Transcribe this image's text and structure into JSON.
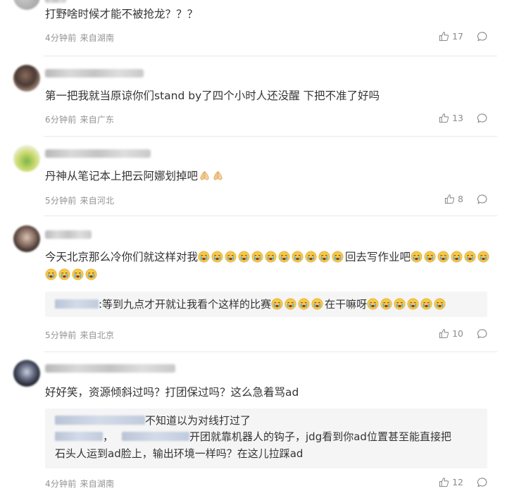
{
  "comments": [
    {
      "text": "打野啥时候才能不被抢龙？？？",
      "time": "4分钟前",
      "location": "来自湖南",
      "likes": "17"
    },
    {
      "text": "第一把我就当原谅你们stand by了四个小时人还没醒 下把不准了好吗",
      "time": "6分钟前",
      "location": "来自广东",
      "likes": "13"
    },
    {
      "text": "丹神从笔记本上把云阿娜划掉吧",
      "time": "5分钟前",
      "location": "来自河北",
      "likes": "8"
    },
    {
      "text_a": "今天北京那么冷你们就这样对我",
      "text_b": "回去写作业吧",
      "reply_text_a": ":等到九点才开就让我看个这样的比赛",
      "reply_text_b": "在干嘛呀",
      "time": "5分钟前",
      "location": "来自北京",
      "likes": "10"
    },
    {
      "text": "好好笑，资源倾斜过吗？打团保过吗？这么急着骂ad",
      "reply_1": "不知道以为对线打过了",
      "reply_2_sep": "，",
      "reply_2": "开团就靠机器人的钩子，jdg看到你ad位置甚至能直接把",
      "reply_3": "石头人运到ad脸上，输出环境一样吗？在这儿拉踩ad",
      "time": "4分钟前",
      "location": "来自湖南",
      "likes": "12"
    }
  ],
  "icons": {
    "like": "thumbs-up-icon",
    "reply": "comment-bubble-icon",
    "emoji_hands": "praying-hands-emoji",
    "emoji_cry": "crying-face-emoji"
  },
  "colors": {
    "text": "#333333",
    "meta": "#939393",
    "reply_bg": "#f5f5f5",
    "divider": "#e9e9e9"
  }
}
